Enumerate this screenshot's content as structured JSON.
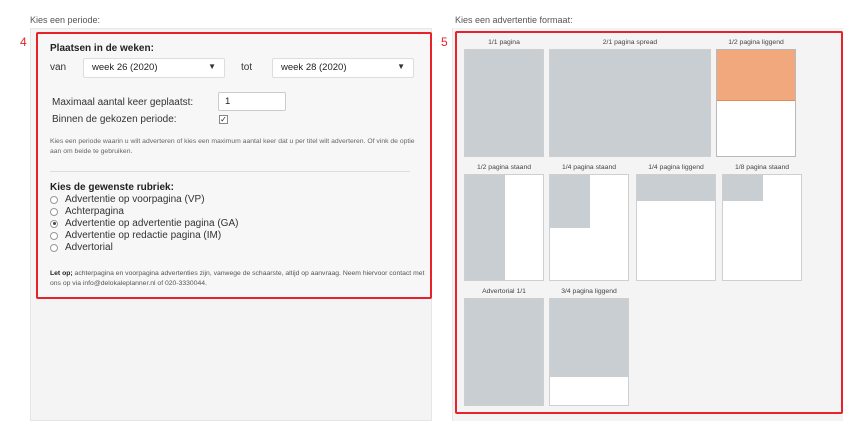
{
  "periode": {
    "heading": "Kies een periode:",
    "marker": "4",
    "weeks_title": "Plaatsen in de weken:",
    "from_label": "van",
    "from_value": "week 26 (2020)",
    "to_label": "tot",
    "to_value": "week 28 (2020)",
    "max_label": "Maximaal aantal keer geplaatst:",
    "max_value": "1",
    "within_label": "Binnen de gekozen periode:",
    "within_checked": true,
    "help_text": "Kies een periode waarin u wilt adverteren of kies een maximum aantal keer dat u per titel wilt adverteren. Of vink de optie aan om beide te gebruiken.",
    "rubriek_title": "Kies de gewenste rubriek:",
    "rubrieken": [
      {
        "label": "Advertentie op voorpagina (VP)",
        "selected": false
      },
      {
        "label": "Achterpagina",
        "selected": false
      },
      {
        "label": "Advertentie op advertentie pagina (GA)",
        "selected": true
      },
      {
        "label": "Advertentie op redactie pagina (IM)",
        "selected": false
      },
      {
        "label": "Advertorial",
        "selected": false
      }
    ],
    "note_bold": "Let op;",
    "note_text": " achterpagina en voorpagina advertenties zijn, vanwege de schaarste, altijd op aanvraag. Neem hiervoor contact met ons op via info@delokaleplanner.nl of 020-3330044."
  },
  "formaat": {
    "heading": "Kies een advertentie formaat:",
    "marker": "5",
    "selected_color": "#f1a87c",
    "items": [
      {
        "label": "1/1 pagina",
        "selected": false
      },
      {
        "label": "2/1 pagina spread",
        "selected": false
      },
      {
        "label": "1/2 pagina liggend",
        "selected": true
      },
      {
        "label": "1/2 pagina staand",
        "selected": false
      },
      {
        "label": "1/4 pagina staand",
        "selected": false
      },
      {
        "label": "1/4 pagina liggend",
        "selected": false
      },
      {
        "label": "1/8 pagina staand",
        "selected": false
      },
      {
        "label": "Advertorial 1/1",
        "selected": false
      },
      {
        "label": "3/4 pagina liggend",
        "selected": false
      }
    ]
  }
}
